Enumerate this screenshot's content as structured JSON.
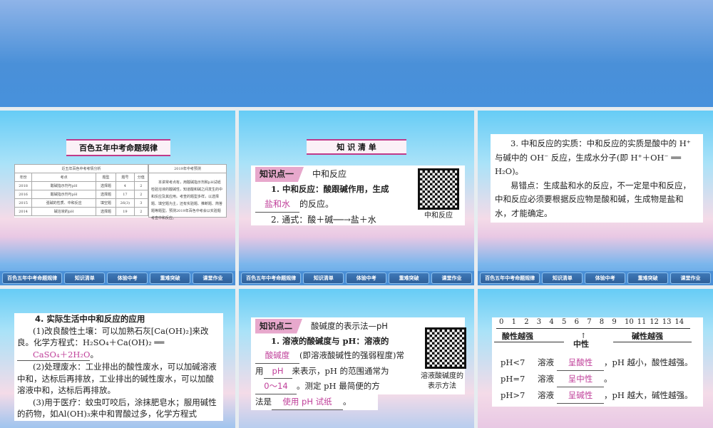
{
  "nav": [
    "百色五年中考命题规律",
    "知识清单",
    "体验中考",
    "重难突破",
    "课堂作业"
  ],
  "slide1": {
    "banner": "百色五年中考命题规律",
    "table_title": "近五年百色中考考情分析",
    "prediction_title": "2019年中考预测",
    "headers": [
      "年份",
      "考点",
      "题型",
      "题号",
      "分值"
    ],
    "rows": [
      [
        "2018",
        "酸碱指示剂与pH",
        "选择题",
        "4",
        "2"
      ],
      [
        "2016",
        "酸碱指示剂与pH",
        "选择题",
        "17",
        "2"
      ],
      [
        "2015",
        "强碱的性质、中和反应",
        "填空题",
        "26(3)",
        "3"
      ],
      [
        "2014",
        "碱溶液的pH",
        "选择题",
        "19",
        "2"
      ]
    ],
    "prediction": "本讲常考点有，用酸碱指示剂和pH试纸检验溶液的酸碱性，知道酸和碱之间发生的中和反应及其应用。考查的题型多样，以选择题、填空题为主，还有实验题、推断题、简答题等题型。预测2019年百色中考会以实验题考查中和反应。"
  },
  "slide2": {
    "banner": "知 识 清 单",
    "tag": "知识点一",
    "topic": "中和反应",
    "p1": "1. 中和反应：酸跟碱作用，生成",
    "a1": "盐和水",
    "p1b": "的反应。",
    "p2": "2. 通式：酸＋碱──→盐＋水",
    "qr_caption": "中和反应"
  },
  "slide3": {
    "p1": "3. 中和反应的实质：中和反应的实质是酸中的 H⁺ 与碱中的 OH⁻ 反应，生成水分子(即 H⁺＋OH⁻ ══ H₂O)。",
    "p2": "易错点：生成盐和水的反应，不一定是中和反应，中和反应必须要根据反应物是酸和碱，生成物是盐和水，才能确定。"
  },
  "slide4": {
    "title": "4. 实际生活中中和反应的应用",
    "p1": "(1)改良酸性土壤：可以加熟石灰[Ca(OH)₂]来改良。化学方程式：H₂SO₄＋Ca(OH)₂ ══",
    "a1": "CaSO₄＋2H₂O",
    "p1b": "。",
    "p2": "(2)处理废水：工业排出的酸性废水，可以加碱溶液中和，达标后再排放，工业排出的碱性废水，可以加酸溶液中和，达标后再排放。",
    "p3": "(3)用于医疗：蚊虫叮咬后，涂抹肥皂水；服用碱性的药物，如Al(OH)₃来中和胃酸过多，化学方程式"
  },
  "slide5": {
    "tag": "知识点二",
    "topic": "酸碱度的表示法—pH",
    "p1": "1. 溶液的酸碱度与 pH：溶液的",
    "a1": "酸碱度",
    "p1b": "(即溶液酸碱性的强弱程度)常用",
    "a2": "pH",
    "p1c": "来表示，pH 的范围通常为",
    "a3": "0～14",
    "p1d": "。测定 pH 最简便的方",
    "p2": "法是",
    "a4": "使用 pH 试纸",
    "p2b": "。",
    "qr_caption": "溶液酸碱度的表示方法"
  },
  "slide6": {
    "scale": [
      "0",
      "1",
      "2",
      "3",
      "4",
      "5",
      "6",
      "7",
      "8",
      "9",
      "10",
      "11",
      "12",
      "13",
      "14"
    ],
    "acid": "酸性越强",
    "neutral": "中性",
    "base": "碱性越强",
    "rows": [
      {
        "cond": "pH<7",
        "sol": "溶液",
        "ans": "呈酸性",
        "tail": "，pH 越小，酸性越强。"
      },
      {
        "cond": "pH=7",
        "sol": "溶液",
        "ans": "呈中性",
        "tail": "。"
      },
      {
        "cond": "pH>7",
        "sol": "溶液",
        "ans": "呈碱性",
        "tail": "，pH 越大，碱性越强。"
      }
    ]
  }
}
